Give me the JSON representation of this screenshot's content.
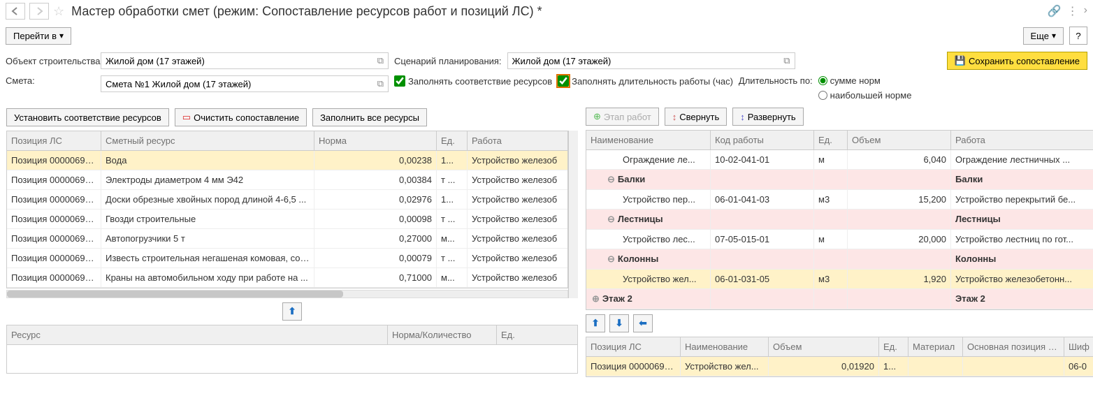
{
  "titlebar": {
    "title": "Мастер обработки смет (режим: Сопоставление ресурсов работ и позиций ЛС) *"
  },
  "toolbar": {
    "goto": "Перейти в",
    "more": "Еще",
    "help": "?"
  },
  "form": {
    "object_label": "Объект строительства:",
    "object_value": "Жилой дом (17 этажей)",
    "scenario_label": "Сценарий планирования:",
    "scenario_value": "Жилой дом (17 этажей)",
    "save_btn": "Сохранить сопоставление",
    "estimate_label": "Смета:",
    "estimate_value": "Смета №1 Жилой дом (17 этажей)",
    "fill_resources": "Заполнять соответствие ресурсов",
    "fill_duration": "Заполнять длительность работы (час)",
    "duration_by": "Длительность по:",
    "sum_norm": "сумме норм",
    "max_norm": "наибольшей норме"
  },
  "left": {
    "btn_set": "Установить соответствие ресурсов",
    "btn_clear": "Очистить сопоставление",
    "btn_fill": "Заполнить все ресурсы",
    "headers": {
      "pos": "Позиция ЛС",
      "res": "Сметный ресурс",
      "norm": "Норма",
      "unit": "Ед.",
      "work": "Работа"
    },
    "rows": [
      {
        "pos": "Позиция 00000693...",
        "res": "Вода",
        "norm": "0,00238",
        "unit": "1...",
        "work": "Устройство железоб"
      },
      {
        "pos": "Позиция 00000693...",
        "res": "Электроды диаметром 4 мм Э42",
        "norm": "0,00384",
        "unit": "т ...",
        "work": "Устройство железоб"
      },
      {
        "pos": "Позиция 00000693...",
        "res": "Доски обрезные хвойных пород длиной 4-6,5 ...",
        "norm": "0,02976",
        "unit": "1...",
        "work": "Устройство железоб"
      },
      {
        "pos": "Позиция 00000693...",
        "res": "Гвозди строительные",
        "norm": "0,00098",
        "unit": "т ...",
        "work": "Устройство железоб"
      },
      {
        "pos": "Позиция 00000693...",
        "res": "Автопогрузчики 5 т",
        "norm": "0,27000",
        "unit": "м...",
        "work": "Устройство железоб"
      },
      {
        "pos": "Позиция 00000693...",
        "res": "Известь строительная негашеная комовая, сорт I",
        "norm": "0,00079",
        "unit": "т ...",
        "work": "Устройство железоб"
      },
      {
        "pos": "Позиция 00000693...",
        "res": "Краны на автомобильном ходу при работе на ...",
        "norm": "0,71000",
        "unit": "м...",
        "work": "Устройство железоб"
      }
    ],
    "bottom_headers": {
      "res": "Ресурс",
      "norm": "Норма/Количество",
      "unit": "Ед."
    }
  },
  "right": {
    "btn_stage": "Этап работ",
    "btn_collapse": "Свернуть",
    "btn_expand": "Развернуть",
    "headers": {
      "name": "Наименование",
      "code": "Код работы",
      "unit": "Ед.",
      "vol": "Объем",
      "work": "Работа"
    },
    "rows": [
      {
        "type": "leaf",
        "indent": 2,
        "name": "Ограждение ле...",
        "code": "10-02-041-01",
        "unit": "м",
        "vol": "6,040",
        "work": "Ограждение лестничных ..."
      },
      {
        "type": "group",
        "indent": 1,
        "name": "Балки",
        "code": "",
        "unit": "",
        "vol": "",
        "work": "Балки"
      },
      {
        "type": "leaf",
        "indent": 2,
        "name": "Устройство пер...",
        "code": "06-01-041-03",
        "unit": "м3",
        "vol": "15,200",
        "work": "Устройство перекрытий бе..."
      },
      {
        "type": "group",
        "indent": 1,
        "name": "Лестницы",
        "code": "",
        "unit": "",
        "vol": "",
        "work": "Лестницы"
      },
      {
        "type": "leaf",
        "indent": 2,
        "name": "Устройство лес...",
        "code": "07-05-015-01",
        "unit": "м",
        "vol": "20,000",
        "work": "Устройство лестниц по гот..."
      },
      {
        "type": "group",
        "indent": 1,
        "name": "Колонны",
        "code": "",
        "unit": "",
        "vol": "",
        "work": "Колонны"
      },
      {
        "type": "leaf-sel",
        "indent": 2,
        "name": "Устройство жел...",
        "code": "06-01-031-05",
        "unit": "м3",
        "vol": "1,920",
        "work": "Устройство железобетонн..."
      },
      {
        "type": "group-closed",
        "indent": 0,
        "name": "Этаж 2",
        "code": "",
        "unit": "",
        "vol": "",
        "work": "Этаж 2"
      }
    ],
    "bottom_headers": {
      "pos": "Позиция ЛС",
      "name": "Наименование",
      "vol": "Объем",
      "unit": "Ед.",
      "mat": "Материал",
      "main": "Основная позиция ЛС",
      "code": "Шиф"
    },
    "bottom_row": {
      "pos": "Позиция 00000693...",
      "name": "Устройство жел...",
      "vol": "0,01920",
      "unit": "1...",
      "mat": "",
      "main": "",
      "code": "06-0"
    }
  }
}
